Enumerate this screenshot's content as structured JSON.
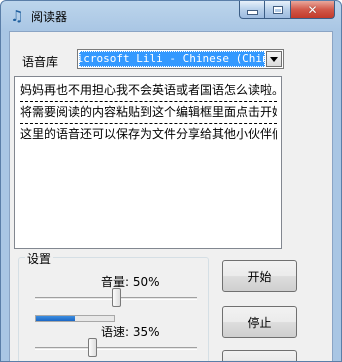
{
  "window": {
    "title": "阅读器",
    "icon": "music-note-icon",
    "minimize_icon": "minimize-icon",
    "maximize_icon": "maximize-icon",
    "close_icon": "close-icon",
    "close_glyph": "✕"
  },
  "voice": {
    "label": "语音库",
    "selected": "Microsoft Lili - Chinese (China)"
  },
  "text_content": {
    "lines": [
      "妈妈再也不用担心我不会英语或者国语怎么读啦。",
      "将需要阅读的内容粘贴到这个编辑框里面点击开始",
      "这里的语音还可以保存为文件分享给其他小伙伴们"
    ]
  },
  "settings": {
    "title": "设置",
    "volume_label": "音量: 50%",
    "volume": 0.5,
    "speed_label": "语速: 35%",
    "speed": 0.35
  },
  "buttons": {
    "start": "开始",
    "stop": "停止",
    "third": ""
  },
  "colors": {
    "selection": "#3399ff",
    "progress": "#2a7bd6",
    "close_button": "#c23a2a"
  }
}
